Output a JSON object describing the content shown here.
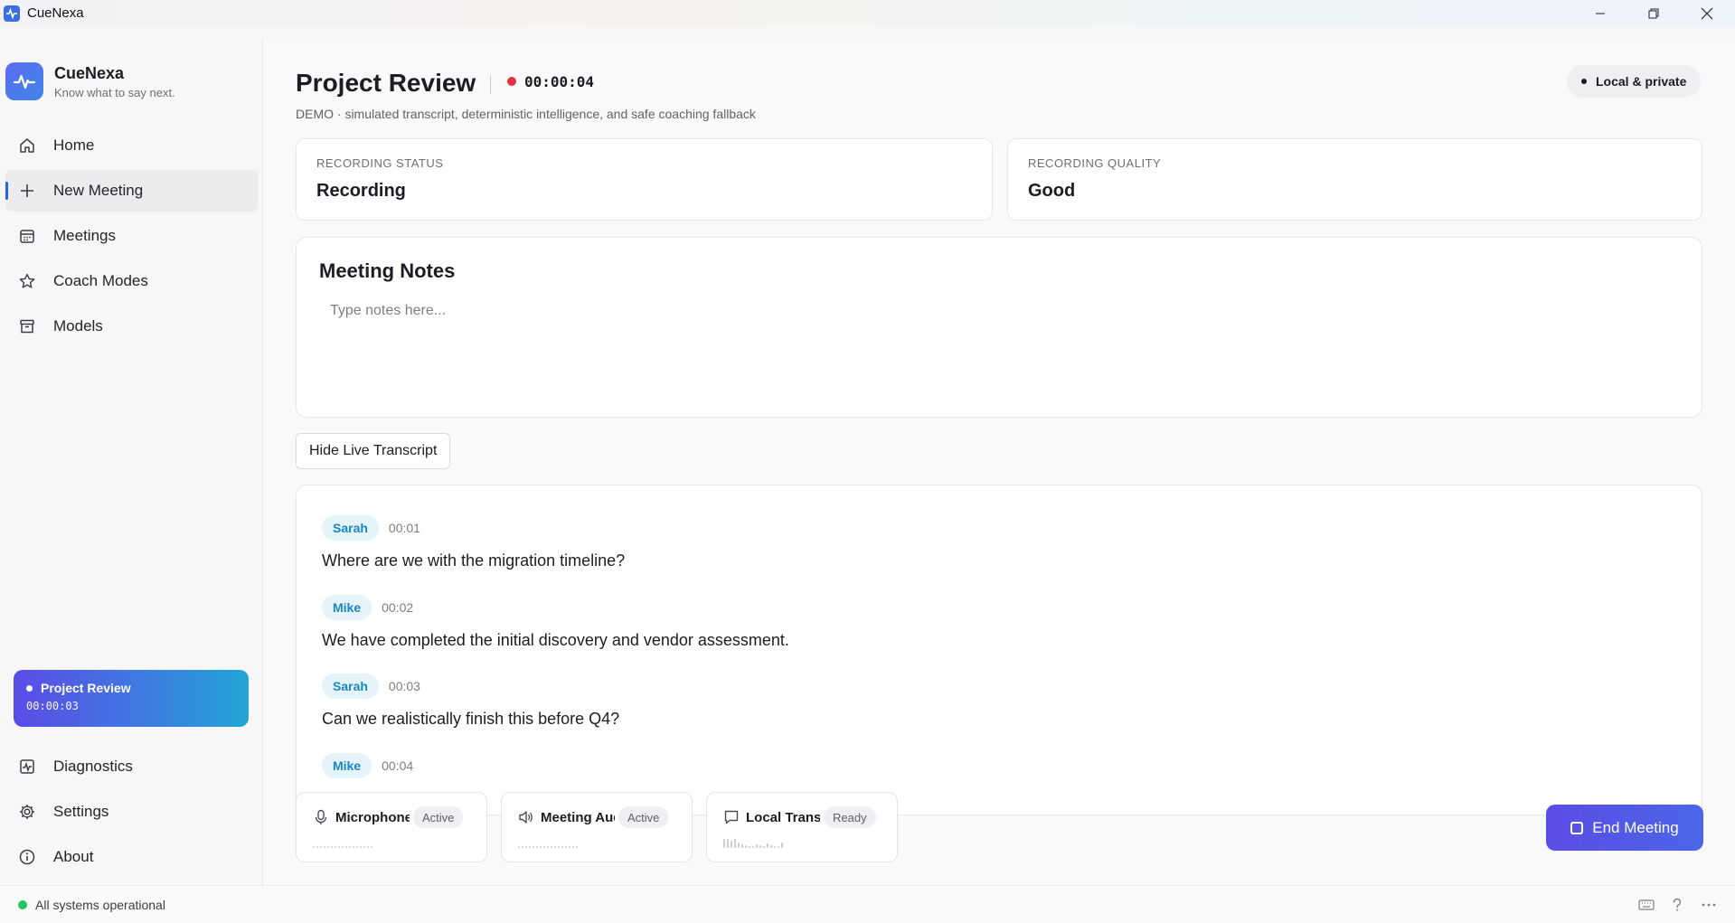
{
  "window": {
    "title": "CueNexa"
  },
  "brand": {
    "name": "CueNexa",
    "tagline": "Know what to say next."
  },
  "nav": {
    "items": [
      {
        "label": "Home",
        "icon": "home-icon"
      },
      {
        "label": "New Meeting",
        "icon": "plus-icon",
        "active": true
      },
      {
        "label": "Meetings",
        "icon": "calendar-icon"
      },
      {
        "label": "Coach Modes",
        "icon": "star-icon"
      },
      {
        "label": "Models",
        "icon": "archive-icon"
      }
    ],
    "bottom": [
      {
        "label": "Diagnostics",
        "icon": "activity-icon"
      },
      {
        "label": "Settings",
        "icon": "gear-icon"
      },
      {
        "label": "About",
        "icon": "info-icon"
      }
    ]
  },
  "active_session": {
    "title": "Project Review",
    "time": "00:00:03"
  },
  "header": {
    "title": "Project Review",
    "timer": "00:00:04",
    "subtitle": "DEMO · simulated transcript, deterministic intelligence, and safe coaching fallback",
    "privacy": "Local & private"
  },
  "stats": [
    {
      "label": "RECORDING STATUS",
      "value": "Recording"
    },
    {
      "label": "RECORDING QUALITY",
      "value": "Good"
    }
  ],
  "notes": {
    "title": "Meeting Notes",
    "placeholder": "Type notes here...",
    "value": ""
  },
  "transcript_toggle": {
    "label": "Hide Live Transcript"
  },
  "transcript": [
    {
      "speaker": "Sarah",
      "time": "00:01",
      "text": "Where are we with the migration timeline?"
    },
    {
      "speaker": "Mike",
      "time": "00:02",
      "text": "We have completed the initial discovery and vendor assessment."
    },
    {
      "speaker": "Sarah",
      "time": "00:03",
      "text": "Can we realistically finish this before Q4?"
    },
    {
      "speaker": "Mike",
      "time": "00:04",
      "text": ""
    }
  ],
  "devices": [
    {
      "name": "Microphone",
      "status": "Active",
      "icon": "microphone-icon"
    },
    {
      "name": "Meeting Audio",
      "status": "Active",
      "icon": "speaker-icon"
    },
    {
      "name": "Local Transcription",
      "status": "Ready",
      "icon": "chat-icon"
    }
  ],
  "end_button": {
    "label": "End Meeting"
  },
  "status_bar": {
    "text": "All systems operational"
  },
  "colors": {
    "accent": "#5b4ce6",
    "recording": "#e1333f",
    "ok": "#22c55e",
    "speaker": "#1987c2"
  }
}
